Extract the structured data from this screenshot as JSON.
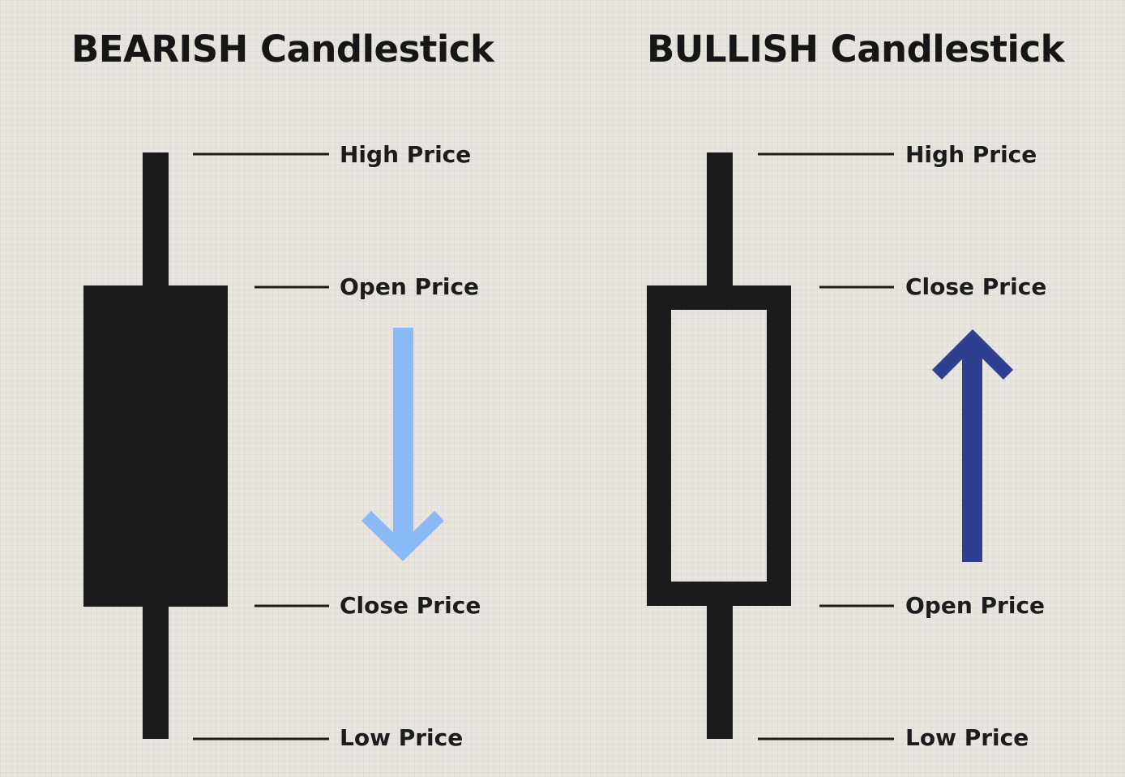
{
  "bearish": {
    "title": "BEARISH Candlestick",
    "labels": {
      "high": "High Price",
      "open": "Open Price",
      "close": "Close Price",
      "low": "Low Price"
    },
    "body_style": "filled",
    "arrow": {
      "direction": "down",
      "color": "#8ab9f7"
    }
  },
  "bullish": {
    "title": "BULLISH Candlestick",
    "labels": {
      "high": "High Price",
      "close": "Close Price",
      "open": "Open Price",
      "low": "Low Price"
    },
    "body_style": "hollow",
    "arrow": {
      "direction": "up",
      "color": "#2e3f8f"
    }
  },
  "colors": {
    "candle": "#1b1b1b",
    "text": "#1c1c1c",
    "background": "#e8e5df"
  }
}
